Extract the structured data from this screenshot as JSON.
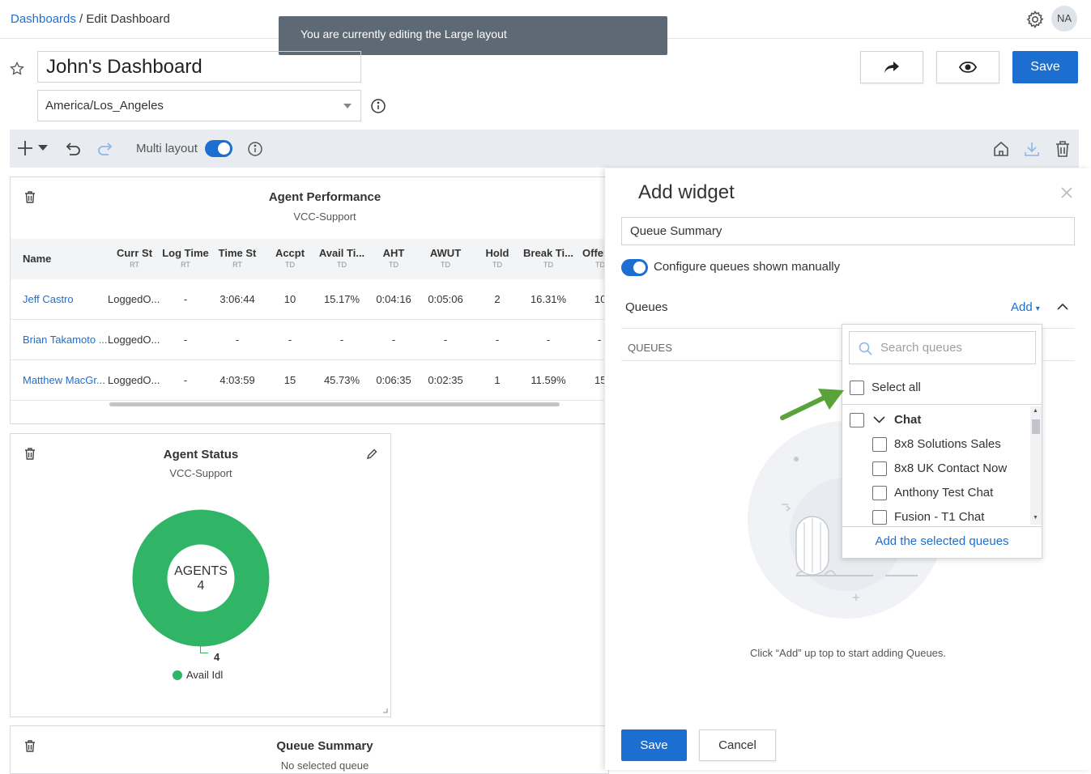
{
  "breadcrumb": {
    "root": "Dashboards",
    "separator": " / ",
    "current": "Edit Dashboard"
  },
  "toast": "You are currently editing the Large layout",
  "user": {
    "initials": "NA"
  },
  "dashboard": {
    "title": "John's Dashboard",
    "timezone": "America/Los_Angeles"
  },
  "header_buttons": {
    "save": "Save"
  },
  "toolbar": {
    "multi_layout_label": "Multi layout",
    "multi_layout_on": true
  },
  "agent_performance": {
    "title": "Agent Performance",
    "subtitle": "VCC-Support",
    "columns": [
      {
        "label": "Name",
        "sub": ""
      },
      {
        "label": "Curr St",
        "sub": "RT"
      },
      {
        "label": "Log Time",
        "sub": "RT"
      },
      {
        "label": "Time St",
        "sub": "RT"
      },
      {
        "label": "Accpt",
        "sub": "TD"
      },
      {
        "label": "Avail Ti...",
        "sub": "TD"
      },
      {
        "label": "AHT",
        "sub": "TD"
      },
      {
        "label": "AWUT",
        "sub": "TD"
      },
      {
        "label": "Hold",
        "sub": "TD"
      },
      {
        "label": "Break Ti...",
        "sub": "TD"
      },
      {
        "label": "Offer",
        "sub": "TD"
      }
    ],
    "rows": [
      [
        "Jeff Castro",
        "LoggedO...",
        "-",
        "3:06:44",
        "10",
        "15.17%",
        "0:04:16",
        "0:05:06",
        "2",
        "16.31%",
        "10"
      ],
      [
        "Brian Takamoto ...",
        "LoggedO...",
        "-",
        "-",
        "-",
        "-",
        "-",
        "-",
        "-",
        "-",
        "-"
      ],
      [
        "Matthew MacGr...",
        "LoggedO...",
        "-",
        "4:03:59",
        "15",
        "45.73%",
        "0:06:35",
        "0:02:35",
        "1",
        "11.59%",
        "15"
      ]
    ]
  },
  "agent_status": {
    "title": "Agent Status",
    "subtitle": "VCC-Support",
    "center_label": "AGENTS",
    "center_value": "4",
    "slice_value": "4",
    "legend": "Avail Idl",
    "color": "#2fb565"
  },
  "queue_summary_widget": {
    "title": "Queue Summary",
    "subtitle": "No selected queue"
  },
  "add_widget": {
    "heading": "Add widget",
    "widget_name": "Queue Summary",
    "configure_label": "Configure queues shown manually",
    "configure_on": true,
    "queues_label": "Queues",
    "add_label": "Add",
    "queues_column": "QUEUES",
    "empty_message": "Click “Add” up top to start adding Queues.",
    "save": "Save",
    "cancel": "Cancel"
  },
  "queue_dropdown": {
    "search_placeholder": "Search queues",
    "select_all": "Select all",
    "group": "Chat",
    "items": [
      "8x8 Solutions Sales",
      "8x8 UK Contact Now",
      "Anthony Test Chat",
      "Fusion - T1 Chat"
    ],
    "add_selected": "Add the selected queues"
  },
  "colors": {
    "accent": "#1c6fd1",
    "arrow": "#5aa33a",
    "toast": "#5d6a75"
  }
}
